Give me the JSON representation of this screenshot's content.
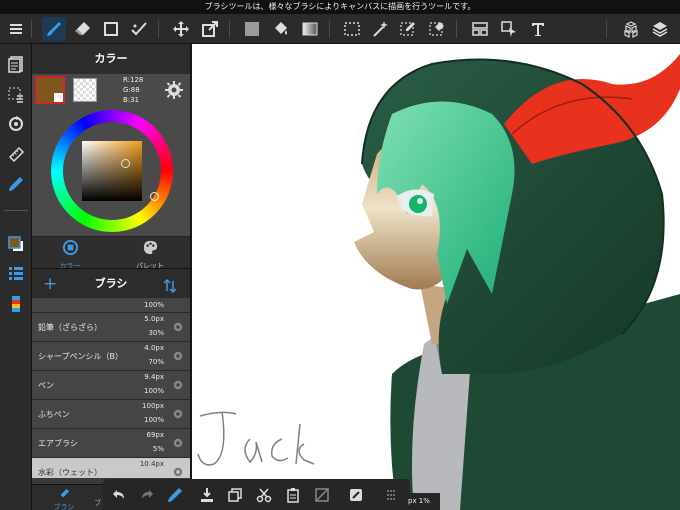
{
  "tooltip": "ブラシツールは、様々なブラシによりキャンバスに描画を行うツールです。",
  "panel": {
    "color_title": "カラー",
    "rgb": {
      "r": "R:128",
      "g": "G:88",
      "b": "B:31"
    },
    "main_color": "#80581f",
    "tabs": [
      {
        "label": "カラー"
      },
      {
        "label": "パレット"
      }
    ],
    "brush_title": "ブラシ",
    "brushes": [
      {
        "name": "",
        "size": "",
        "opacity": "100%"
      },
      {
        "name": "鉛筆（ざらざら）",
        "size": "5.0px",
        "opacity": "30%"
      },
      {
        "name": "シャープペンシル（B）",
        "size": "4.0px",
        "opacity": "70%"
      },
      {
        "name": "ペン",
        "size": "9.4px",
        "opacity": "100%"
      },
      {
        "name": "ふちペン",
        "size": "100px",
        "opacity": "100%"
      },
      {
        "name": "エアブラシ",
        "size": "69px",
        "opacity": "5%"
      },
      {
        "name": "水彩（ウェット）",
        "size": "10.4px",
        "opacity": ""
      }
    ],
    "footer": {
      "brush": "ブラシ",
      "other": "ブ"
    }
  },
  "canvas": {
    "signature": "Jack"
  },
  "status": {
    "zoom": "px 1%"
  },
  "colors": {
    "accent": "#3b9be8",
    "toolbar": "#2b2b2b",
    "hood": "#1e4a35",
    "horn": "#e8321e"
  }
}
